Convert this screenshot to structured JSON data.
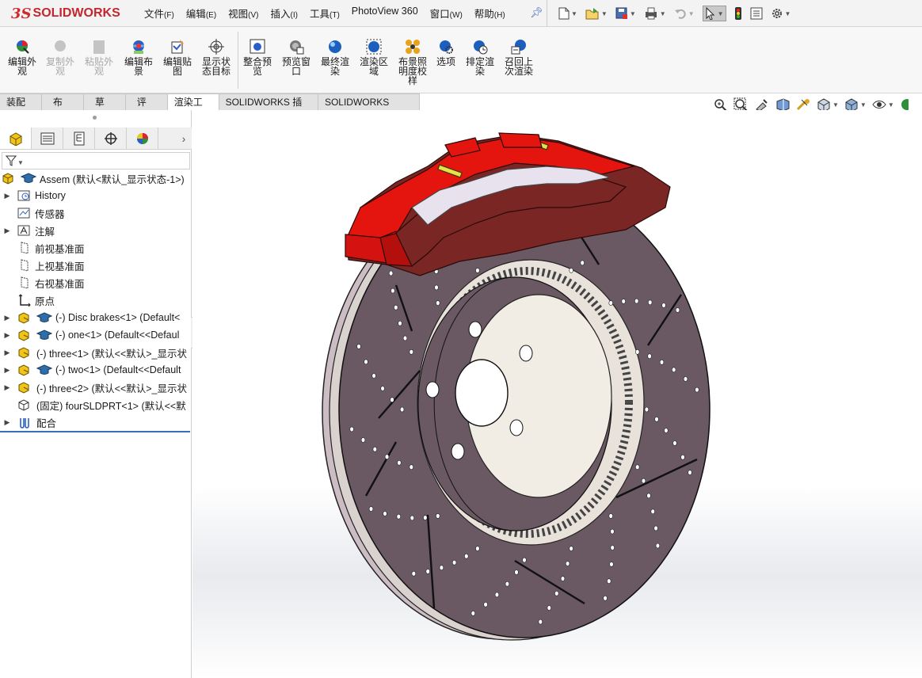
{
  "app": {
    "logo_prefix": "3S",
    "logo_text": "SOLIDWORKS"
  },
  "menu": [
    {
      "label": "文件",
      "key": "(F)"
    },
    {
      "label": "编辑",
      "key": "(E)"
    },
    {
      "label": "视图",
      "key": "(V)"
    },
    {
      "label": "插入",
      "key": "(I)"
    },
    {
      "label": "工具",
      "key": "(T)"
    },
    {
      "label": "PhotoView 360",
      "key": ""
    },
    {
      "label": "窗口",
      "key": "(W)"
    },
    {
      "label": "帮助",
      "key": "(H)"
    }
  ],
  "quick_access": [
    "new-document-icon",
    "open-icon",
    "save-icon",
    "print-icon",
    "undo-icon",
    "select-icon",
    "traffic-light-icon",
    "options-list-icon",
    "gear-icon"
  ],
  "ribbon": {
    "buttons": [
      {
        "label": "编辑外观",
        "enabled": true,
        "icon": "edit-appearance-icon"
      },
      {
        "label": "复制外观",
        "enabled": false,
        "icon": "copy-appearance-icon"
      },
      {
        "label": "粘贴外观",
        "enabled": false,
        "icon": "paste-appearance-icon"
      },
      {
        "label": "编辑布景",
        "enabled": true,
        "icon": "edit-scene-icon"
      },
      {
        "label": "编辑贴图",
        "enabled": true,
        "icon": "edit-decal-icon"
      },
      {
        "label": "显示状态目标",
        "enabled": true,
        "icon": "display-state-target-icon"
      },
      {
        "label": "整合预览",
        "enabled": true,
        "icon": "integrated-preview-icon"
      },
      {
        "label": "预览窗口",
        "enabled": true,
        "icon": "preview-window-icon"
      },
      {
        "label": "最终渲染",
        "enabled": true,
        "icon": "final-render-icon"
      },
      {
        "label": "渲染区域",
        "enabled": true,
        "icon": "render-region-icon"
      },
      {
        "label": "布景照明度校样",
        "enabled": true,
        "icon": "scene-illumination-proof-icon"
      },
      {
        "label": "选项",
        "enabled": true,
        "icon": "options-icon"
      },
      {
        "label": "排定渲染",
        "enabled": true,
        "icon": "schedule-render-icon"
      },
      {
        "label": "召回上次渲染",
        "enabled": true,
        "icon": "recall-last-render-icon"
      }
    ]
  },
  "tabs": [
    {
      "label": "装配体",
      "active": false
    },
    {
      "label": "布局",
      "active": false
    },
    {
      "label": "草图",
      "active": false
    },
    {
      "label": "评估",
      "active": false
    },
    {
      "label": "渲染工具",
      "active": true
    },
    {
      "label": "SOLIDWORKS 插件",
      "active": false
    },
    {
      "label": "SOLIDWORKS MBD",
      "active": false
    }
  ],
  "view_tools": [
    "zoom-to-fit-icon",
    "zoom-to-area-icon",
    "previous-view-icon",
    "section-view-icon",
    "dynamic-annotation-icon",
    "view-orientation-icon",
    "display-style-icon",
    "hide-show-items-icon",
    "appearance-icon"
  ],
  "panel_tabs": [
    "featuremanager-tab-icon",
    "propertymanager-tab-icon",
    "configurationmanager-tab-icon",
    "dimxpert-tab-icon",
    "displaymanager-tab-icon"
  ],
  "tree": [
    {
      "text": "Assem  (默认<默认_显示状态-1>)",
      "icon": "assembly",
      "expand": false,
      "indent": 0
    },
    {
      "text": "History",
      "icon": "history",
      "expand": true,
      "indent": 1
    },
    {
      "text": "传感器",
      "icon": "sensor",
      "expand": false,
      "indent": 1
    },
    {
      "text": "注解",
      "icon": "annotation",
      "expand": true,
      "indent": 1
    },
    {
      "text": "前视基准面",
      "icon": "plane",
      "expand": false,
      "indent": 1
    },
    {
      "text": "上视基准面",
      "icon": "plane",
      "expand": false,
      "indent": 1
    },
    {
      "text": "右视基准面",
      "icon": "plane",
      "expand": false,
      "indent": 1
    },
    {
      "text": "原点",
      "icon": "origin",
      "expand": false,
      "indent": 1
    },
    {
      "text": "(-) Disc brakes<1> (Default<",
      "icon": "subassembly",
      "expand": true,
      "indent": 1
    },
    {
      "text": "(-) one<1> (Default<<Defaul",
      "icon": "subassembly",
      "expand": true,
      "indent": 1
    },
    {
      "text": "(-) three<1> (默认<<默认>_显示状",
      "icon": "part",
      "expand": true,
      "indent": 1
    },
    {
      "text": "(-) two<1> (Default<<Default",
      "icon": "subassembly",
      "expand": true,
      "indent": 1
    },
    {
      "text": "(-) three<2> (默认<<默认>_显示状",
      "icon": "part",
      "expand": true,
      "indent": 1
    },
    {
      "text": "(固定) fourSLDPRT<1> (默认<<默",
      "icon": "fixedpart",
      "expand": false,
      "indent": 1
    },
    {
      "text": "配合",
      "icon": "mates",
      "expand": true,
      "indent": 1
    }
  ],
  "colors": {
    "caliper_red": "#e4150f",
    "caliper_shade": "#7a2624",
    "rotor": "#6a5962",
    "rotor_edge": "#dcd6d2",
    "accent_blue": "#3b6fb5"
  }
}
